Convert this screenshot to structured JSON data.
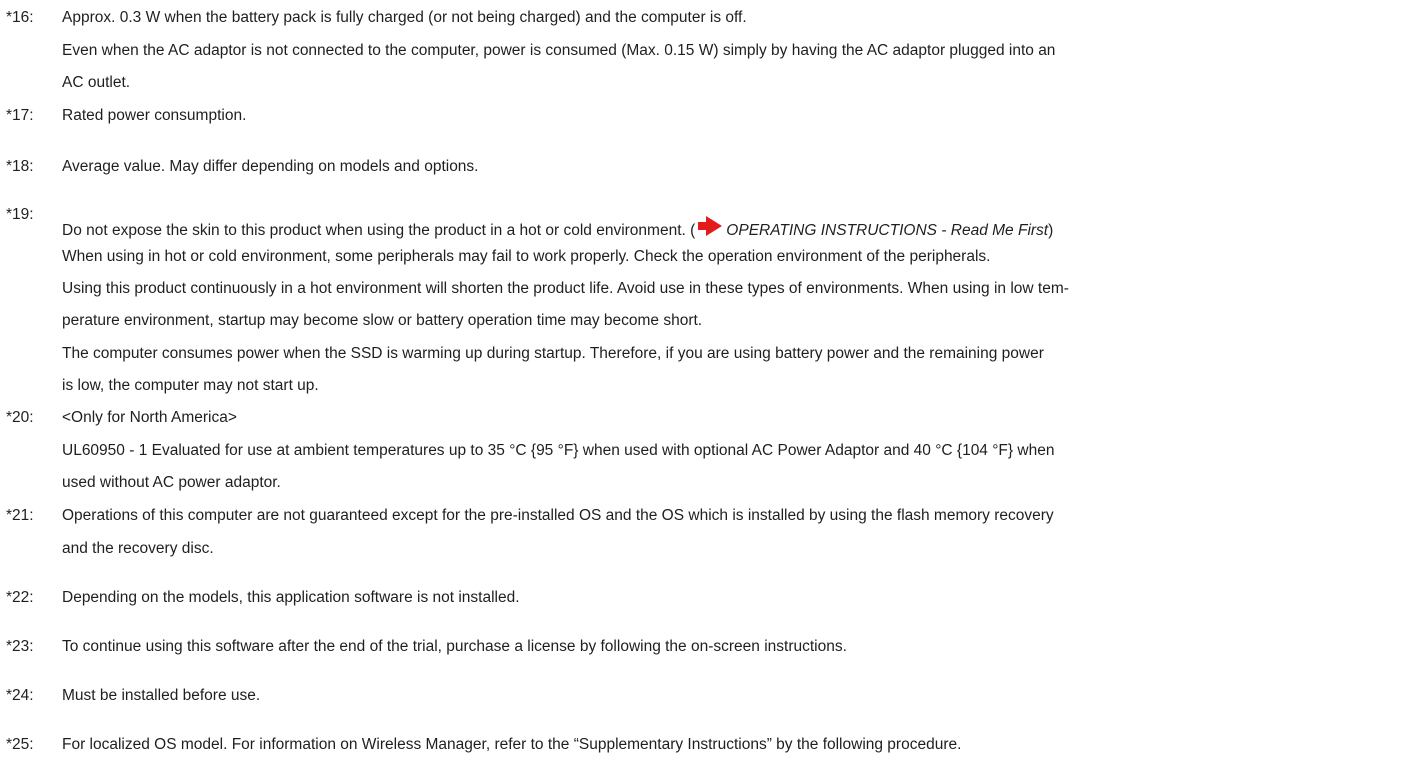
{
  "notes": [
    {
      "number": "*16:",
      "lines": [
        "Approx. 0.3 W when the battery pack is fully charged (or not being charged) and the computer is off.",
        "Even when the AC adaptor is not connected to the computer, power is consumed (Max. 0.15 W) simply by having the AC adaptor plugged into an",
        "AC outlet."
      ]
    },
    {
      "number": "*17:",
      "lines": [
        "Rated power consumption."
      ]
    },
    {
      "number": "*18:",
      "lines": [
        "Average value. May differ depending on models and options."
      ]
    },
    {
      "number": "*19:",
      "first_line": {
        "text": "Do not expose the skin to this product when using the product in a hot or cold environment. (",
        "ref_title": "OPERATING INSTRUCTIONS",
        "ref_sep": " - ",
        "ref_doc": "Read Me First",
        "close": ")"
      },
      "lines": [
        "When using in hot or cold environment, some peripherals may fail to work properly. Check the operation environment of the peripherals.",
        "Using this product continuously in a hot environment will shorten the product life. Avoid use in these types of environments. When using in low tem-",
        "perature environment, startup may become slow or battery operation time may become short.",
        "The computer consumes power when the SSD is warming up during startup. Therefore, if you are using battery power and the remaining power",
        "is low, the computer may not start up."
      ]
    },
    {
      "number": "*20:",
      "lines": [
        "<Only for North America>",
        "UL60950 - 1 Evaluated for use at ambient temperatures up to 35 °C {95 °F} when used with optional AC Power Adaptor and 40 °C {104 °F} when",
        "used without AC power adaptor."
      ]
    },
    {
      "number": "*21:",
      "lines": [
        "Operations of this computer are not guaranteed except for the pre-installed OS and the OS which is installed by using the flash memory recovery",
        "and the recovery disc."
      ]
    },
    {
      "number": "*22:",
      "lines": [
        "Depending on the models, this application software is not installed."
      ]
    },
    {
      "number": "*23:",
      "lines": [
        "To continue using this software after the end of the trial, purchase a license by following the on-screen instructions."
      ]
    },
    {
      "number": "*24:",
      "lines": [
        "Must be installed before use."
      ]
    },
    {
      "number": "*25:",
      "lines": [
        "For localized OS model. For information on Wireless Manager, refer to the “Supplementary Instructions” by the following procedure."
      ]
    }
  ],
  "icons": {
    "reference_arrow": "red-arrow-icon"
  },
  "colors": {
    "text": "#1f1f1f",
    "arrow": "#e31b1b",
    "background": "#ffffff"
  }
}
